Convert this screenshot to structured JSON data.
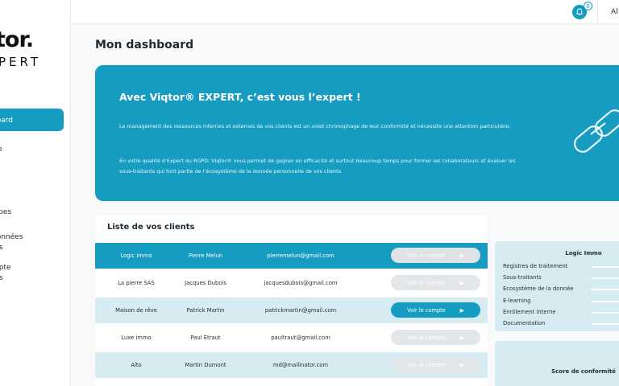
{
  "brand": {
    "logo_main": "tor.",
    "logo_sub": "PERT",
    "accent": "#169cc1"
  },
  "sidebar": {
    "items": [
      {
        "label": "board",
        "active": true
      },
      {
        "label": "ise"
      },
      {
        "label": "uipes"
      },
      {
        "label": "données"
      },
      {
        "label": "ats"
      },
      {
        "label": "mpte"
      },
      {
        "label": "ats"
      }
    ]
  },
  "topbar": {
    "notifications_count": "0",
    "user_initials": "Al",
    "bell_icon": "bell-icon"
  },
  "page": {
    "title": "Mon dashboard"
  },
  "hero": {
    "title": "Avec Viqtor® EXPERT, c’est vous l’expert !",
    "p1": "Le management des ressources internes et externes de vos clients est un volet chronophage de leur conformité et nécessite une attention particulière.",
    "p2": "En votre qualité d’Expert du RGPD, Viqtor® vous permet de gagner en efficacité et surtout beaucoup temps pour former les collaborateurs et évaluer les sous-traitants qui font partie de l’écosystème de la donnée personnelle de vos clients.",
    "art_icon": "chain-link-icon"
  },
  "clients": {
    "title": "Liste de vos clients",
    "button_label": "Voir le compte",
    "rows": [
      {
        "company": "Logic Immo",
        "contact": "Pierre Melun",
        "email": "pierremelun@gmail.com",
        "state": "selected"
      },
      {
        "company": "La pierre SAS",
        "contact": "Jacques Dubois",
        "email": "jacquesdubois@gmail.com",
        "state": "white"
      },
      {
        "company": "Maison de rêve",
        "contact": "Patrick Martin",
        "email": "patrickmartin@gmail.com",
        "state": "light-enabled"
      },
      {
        "company": "Luxe immo",
        "contact": "Paul Etraut",
        "email": "paultraut@gmail.com",
        "state": "white"
      },
      {
        "company": "Alto",
        "contact": "Martin Dumont",
        "email": "md@mailinator.com",
        "state": "light"
      }
    ]
  },
  "detail": {
    "title": "Logic Immo",
    "items": [
      "Registres de traitement",
      "Sous-traitants",
      "Ecosystème de la donnée",
      "E-learning",
      "Enrôlement interne",
      "Documentation"
    ]
  },
  "score": {
    "title": "Score de conformité"
  }
}
